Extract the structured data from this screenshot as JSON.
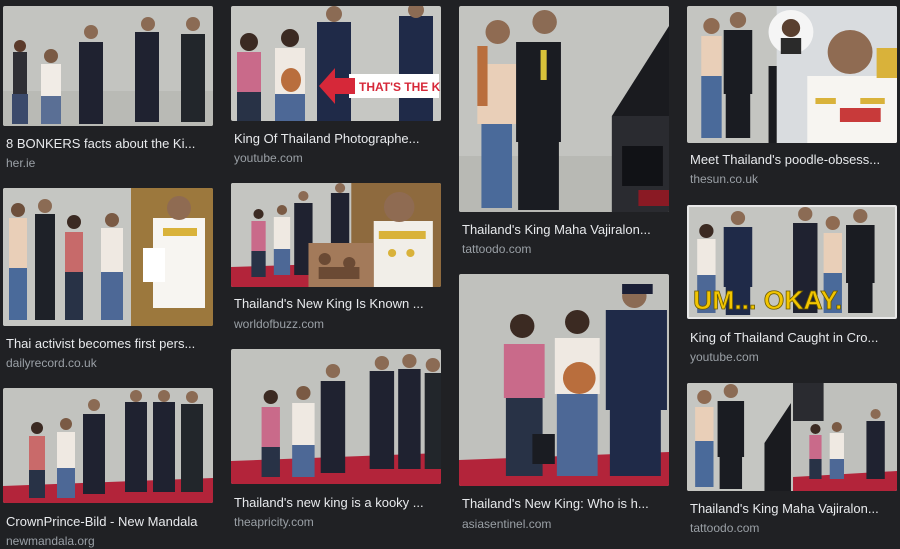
{
  "results": [
    {
      "title": "8 BONKERS facts about the Ki...",
      "source": "her.ie"
    },
    {
      "title": "Thai activist becomes first pers...",
      "source": "dailyrecord.co.uk"
    },
    {
      "title": "CrownPrince-Bild - New Mandala",
      "source": "newmandala.org"
    },
    {
      "title": "King Of Thailand Photographe...",
      "source": "youtube.com",
      "overlay": "THAT'S THE KING"
    },
    {
      "title": "Thailand's New King Is Known ...",
      "source": "worldofbuzz.com"
    },
    {
      "title": "Thailand's new king is a kooky ...",
      "source": "theapricity.com"
    },
    {
      "title": "Thailand's King Maha Vajiralon...",
      "source": "tattoodo.com"
    },
    {
      "title": "Thailand's New King: Who is h...",
      "source": "asiasentinel.com"
    },
    {
      "title": "Meet Thailand's poodle-obsess...",
      "source": "thesun.co.uk"
    },
    {
      "title": "King of Thailand Caught in Cro...",
      "source": "youtube.com",
      "overlay": "UM... OKAY."
    },
    {
      "title": "Thailand's King Maha Vajiralon...",
      "source": "tattoodo.com"
    }
  ],
  "colors": {
    "background": "#202124",
    "title": "#e8eaed",
    "source": "#9aa0a6",
    "tarmac": "#bfc0bc",
    "carpet": "#b3243a",
    "overlay_red": "#d62839",
    "overlay_yellow": "#f2c500"
  }
}
